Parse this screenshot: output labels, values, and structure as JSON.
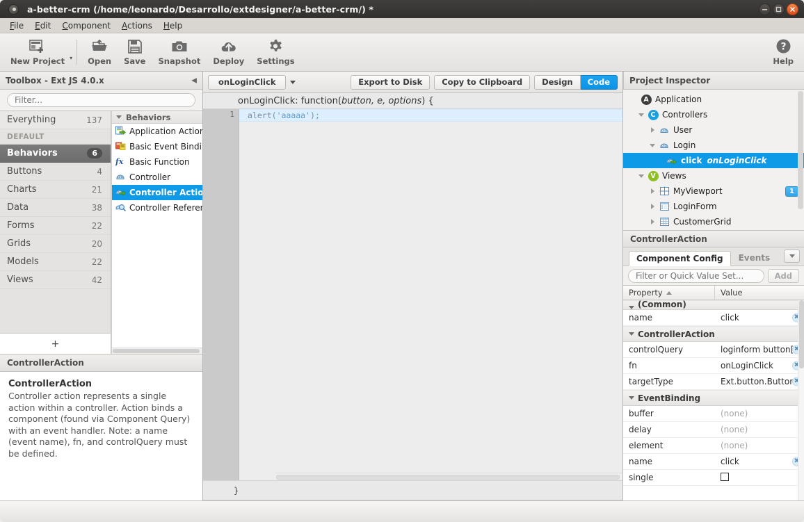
{
  "window": {
    "title": "a-better-crm (/home/leonardo/Desarrollo/extdesigner/a-better-crm/) *",
    "minimize_label": "−",
    "maximize_label": "□",
    "close_label": "✕"
  },
  "menubar": {
    "items": [
      {
        "label": "File",
        "accel": "F"
      },
      {
        "label": "Edit",
        "accel": "E"
      },
      {
        "label": "Component",
        "accel": "C"
      },
      {
        "label": "Actions",
        "accel": "A"
      },
      {
        "label": "Help",
        "accel": "H"
      }
    ]
  },
  "toolbar": {
    "buttons": [
      {
        "label": "New Project",
        "icon": "new-project-icon",
        "has_dropdown": true
      },
      {
        "label": "Open",
        "icon": "open-folder-icon"
      },
      {
        "label": "Save",
        "icon": "floppy-disk-icon"
      },
      {
        "label": "Snapshot",
        "icon": "camera-icon"
      },
      {
        "label": "Deploy",
        "icon": "cloud-upload-icon"
      },
      {
        "label": "Settings",
        "icon": "gear-icon"
      }
    ],
    "help": {
      "label": "Help",
      "icon": "question-circle-icon"
    }
  },
  "toolbox": {
    "header": "Toolbox - Ext JS 4.0.x",
    "collapse_icon": "chevron-left-icon",
    "filter_placeholder": "Filter...",
    "filter_value": "",
    "categories": [
      {
        "label": "Everything",
        "count": "137",
        "type": "everything"
      },
      {
        "label": "DEFAULT",
        "count": "",
        "type": "section"
      },
      {
        "label": "Behaviors",
        "count": "6",
        "type": "item",
        "selected": true
      },
      {
        "label": "Buttons",
        "count": "4",
        "type": "item"
      },
      {
        "label": "Charts",
        "count": "21",
        "type": "item"
      },
      {
        "label": "Data",
        "count": "38",
        "type": "item"
      },
      {
        "label": "Forms",
        "count": "22",
        "type": "item"
      },
      {
        "label": "Grids",
        "count": "20",
        "type": "item"
      },
      {
        "label": "Models",
        "count": "22",
        "type": "item"
      },
      {
        "label": "Views",
        "count": "42",
        "type": "item"
      }
    ],
    "add_button_label": "+",
    "group_header": "Behaviors",
    "items": [
      {
        "label": "Application Action",
        "icon": "application-action-icon",
        "selected": false
      },
      {
        "label": "Basic Event Binding",
        "icon": "basic-event-binding-icon",
        "selected": false
      },
      {
        "label": "Basic Function",
        "icon": "fx-function-icon",
        "selected": false
      },
      {
        "label": "Controller",
        "icon": "controller-icon",
        "selected": false
      },
      {
        "label": "Controller Action",
        "icon": "controller-action-icon",
        "selected": true
      },
      {
        "label": "Controller Reference",
        "icon": "controller-reference-icon",
        "selected": false
      }
    ],
    "desc_header": "ControllerAction",
    "desc_title": "ControllerAction",
    "desc_body": "Controller action represents a single action within a controller. Action binds a component (found via Component Query) with an event handler. Note: a name (event name), fn, and controlQuery must be defined."
  },
  "code": {
    "function_name": "onLoginClick",
    "dropdown_icon": "chevron-down-icon",
    "export_label": "Export to Disk",
    "copy_label": "Copy to Clipboard",
    "design_label": "Design",
    "code_label": "Code",
    "active_view": "Code",
    "signature_prefix": "onLoginClick: function(",
    "signature_args": "button, e, options",
    "signature_suffix": ") {",
    "line_number": "1",
    "line_fn": "alert",
    "line_open": "(",
    "line_string": "'aaaaa'",
    "line_close": ");",
    "closing_brace": "}"
  },
  "inspector": {
    "header": "Project Inspector",
    "nodes": [
      {
        "label": "Application",
        "indent": 0,
        "twisty": "none",
        "icon": "app-badge-icon",
        "badge_letter": "A",
        "badge_color": "#3c3c3c"
      },
      {
        "label": "Controllers",
        "indent": 1,
        "twisty": "down",
        "icon": "controllers-badge-icon",
        "badge_letter": "C",
        "badge_color": "#1a9fe0"
      },
      {
        "label": "User",
        "indent": 2,
        "twisty": "right",
        "icon": "controller-icon"
      },
      {
        "label": "Login",
        "indent": 2,
        "twisty": "down",
        "icon": "controller-icon"
      },
      {
        "label": "click",
        "label2": "onLoginClick",
        "indent": 3,
        "twisty": "none",
        "icon": "controller-action-icon",
        "selected": true
      },
      {
        "label": "Views",
        "indent": 1,
        "twisty": "down",
        "icon": "views-badge-icon",
        "badge_letter": "V",
        "badge_color": "#8cbf1f"
      },
      {
        "label": "MyViewport",
        "indent": 2,
        "twisty": "right",
        "icon": "viewport-icon",
        "count": "1"
      },
      {
        "label": "LoginForm",
        "indent": 2,
        "twisty": "right",
        "icon": "form-icon"
      },
      {
        "label": "CustomerGrid",
        "indent": 2,
        "twisty": "right",
        "icon": "grid-icon"
      }
    ]
  },
  "config": {
    "header": "ControllerAction",
    "tabs": [
      {
        "label": "Component Config",
        "active": true
      },
      {
        "label": "Events",
        "active": false
      }
    ],
    "tabmenu_icon": "chevron-down-icon",
    "filter_placeholder": "Filter or Quick Value Set...",
    "filter_value": "",
    "add_label": "Add",
    "col_property": "Property",
    "col_value": "Value",
    "sort_icon": "sort-ascending-icon",
    "rows": [
      {
        "kind": "group",
        "label": "(Common)",
        "clipped": true
      },
      {
        "kind": "row",
        "property": "name",
        "value": "click",
        "clearable": true
      },
      {
        "kind": "group",
        "label": "ControllerAction"
      },
      {
        "kind": "row",
        "property": "controlQuery",
        "value": "loginform button[i...",
        "clearable": true
      },
      {
        "kind": "row",
        "property": "fn",
        "value": "onLoginClick",
        "clearable": true
      },
      {
        "kind": "row",
        "property": "targetType",
        "value": "Ext.button.Button",
        "clearable": true
      },
      {
        "kind": "group",
        "label": "EventBinding"
      },
      {
        "kind": "row",
        "property": "buffer",
        "value": "(none)",
        "none": true
      },
      {
        "kind": "row",
        "property": "delay",
        "value": "(none)",
        "none": true
      },
      {
        "kind": "row",
        "property": "element",
        "value": "(none)",
        "none": true
      },
      {
        "kind": "row",
        "property": "name",
        "value": "click",
        "clearable": true
      },
      {
        "kind": "row",
        "property": "single",
        "value": "",
        "checkbox": true
      }
    ],
    "clear_icon": "clear-x-icon"
  },
  "colors": {
    "accent": "#0f9ae8",
    "titlebar": "#373532",
    "close_button": "#da4b19",
    "selected_category": "#6d6d6d"
  }
}
